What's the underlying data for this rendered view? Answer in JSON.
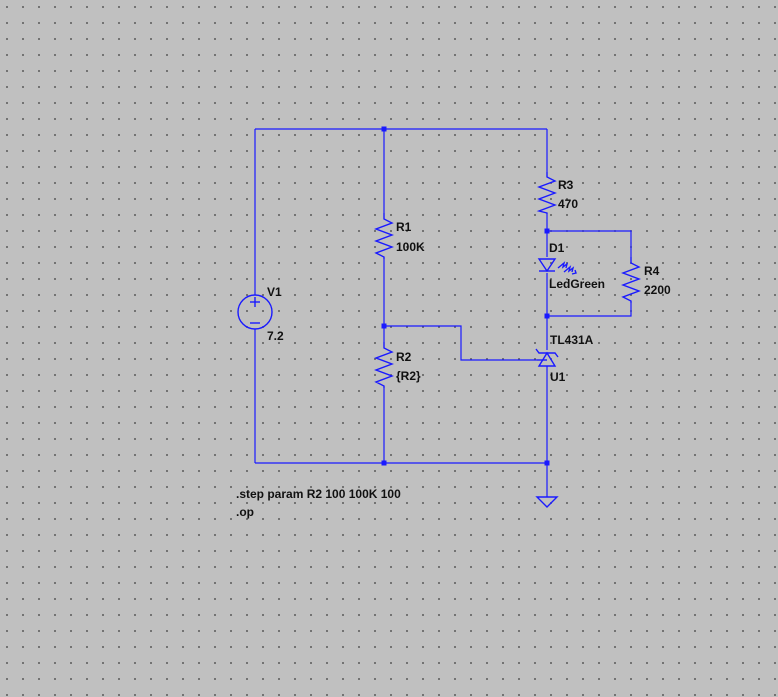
{
  "components": {
    "v1": {
      "name": "V1",
      "value": "7.2"
    },
    "r1": {
      "name": "R1",
      "value": "100K"
    },
    "r2": {
      "name": "R2",
      "value": "{R2}"
    },
    "r3": {
      "name": "R3",
      "value": "470"
    },
    "r4": {
      "name": "R4",
      "value": "2200"
    },
    "d1": {
      "name": "D1",
      "value": "LedGreen"
    },
    "u1": {
      "name": "U1",
      "value": "TL431A"
    }
  },
  "directives": {
    "step": ".step param R2 100 100K 100",
    "op": ".op"
  },
  "colors": {
    "wire": "#1a1aff",
    "background": "#c0c0c0",
    "text": "#111111"
  }
}
